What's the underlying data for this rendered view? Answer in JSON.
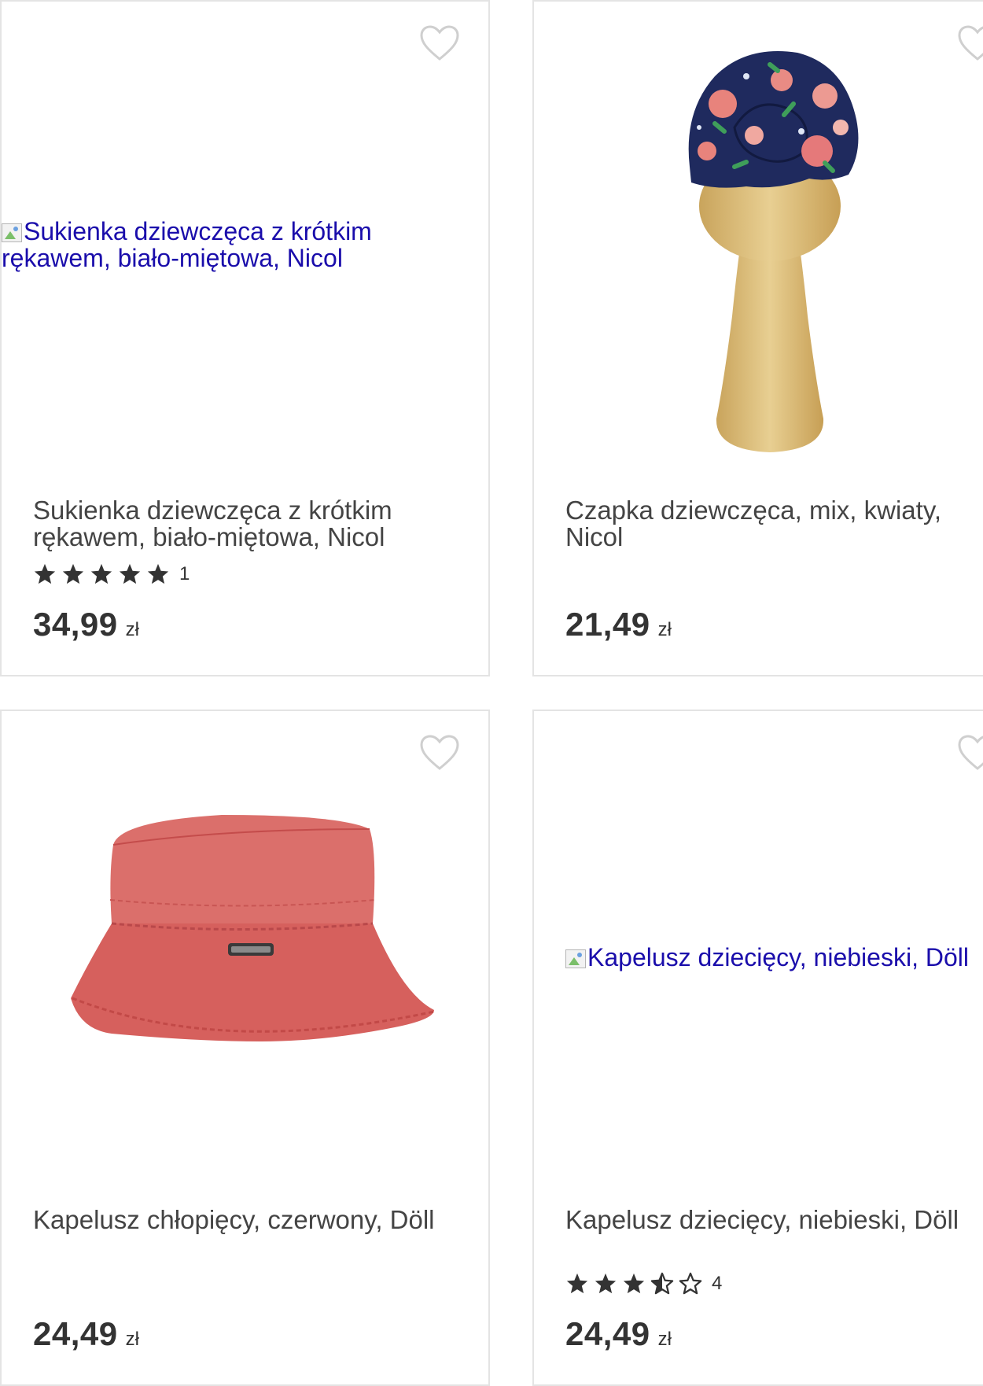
{
  "colors": {
    "card_border": "#e4e4e4",
    "text": "#444444",
    "price": "#333333",
    "link": "#1a0dab",
    "star_filled": "#333333",
    "heart_outline": "#cfcfcf"
  },
  "products": [
    {
      "title": "Sukienka dziewczęca z krótkim rękawem, biało-miętowa, Nicol",
      "image_alt": "Sukienka dziewczęca z krótkim rękawem, biało-miętowa, Nicol",
      "image_loaded": false,
      "rating": 5,
      "rating_count": "1",
      "price": "34,99",
      "currency": "zł"
    },
    {
      "title": "Czapka dziewczęca, mix, kwiaty, Nicol",
      "image_alt": "",
      "image_loaded": true,
      "image_icon": "floral-turban-on-wooden-head",
      "rating": null,
      "rating_count": "",
      "price": "21,49",
      "currency": "zł"
    },
    {
      "title": "Kapelusz chłopięcy, czerwony, Döll",
      "image_alt": "",
      "image_loaded": true,
      "image_icon": "red-bucket-hat",
      "rating": null,
      "rating_count": "",
      "price": "24,49",
      "currency": "zł"
    },
    {
      "title": "Kapelusz dziecięcy, niebieski, Döll",
      "image_alt": "Kapelusz dziecięcy, niebieski, Döll",
      "image_loaded": false,
      "rating": 3.5,
      "rating_count": "4",
      "price": "24,49",
      "currency": "zł"
    }
  ]
}
